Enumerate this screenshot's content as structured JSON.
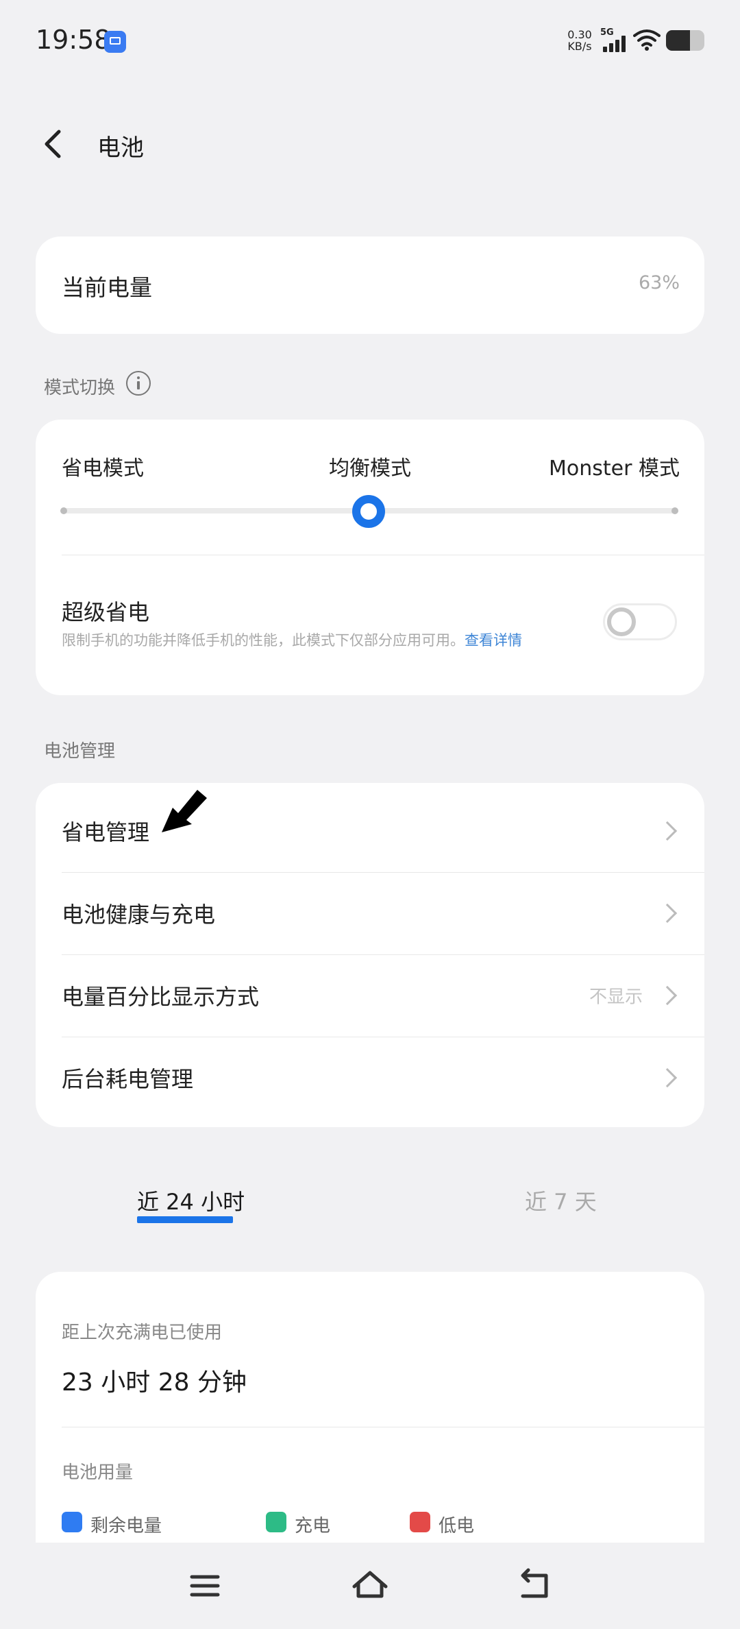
{
  "status_bar": {
    "time": "19:58",
    "net_speed_value": "0.30",
    "net_speed_unit": "KB/s",
    "network_type": "5G",
    "battery_level": 0.63,
    "icons": [
      "screen-cast-icon",
      "cellular-signal-icon",
      "wifi-icon",
      "battery-icon"
    ]
  },
  "header": {
    "title": "电池"
  },
  "battery": {
    "label": "当前电量",
    "value": "63%"
  },
  "mode": {
    "section_title": "模式切换",
    "options": [
      "省电模式",
      "均衡模式",
      "Monster 模式"
    ],
    "selected_index": 1,
    "super_saver_title": "超级省电",
    "super_saver_desc": "限制手机的功能并降低手机的性能，此模式下仅部分应用可用。",
    "super_saver_link": "查看详情",
    "super_saver_enabled": false
  },
  "battery_management": {
    "section_title": "电池管理",
    "items": [
      {
        "label": "省电管理",
        "value": ""
      },
      {
        "label": "电池健康与充电",
        "value": ""
      },
      {
        "label": "电量百分比显示方式",
        "value": "不显示"
      },
      {
        "label": "后台耗电管理",
        "value": ""
      }
    ]
  },
  "tabs": {
    "items": [
      "近 24 小时",
      "近 7 天"
    ],
    "active_index": 0
  },
  "stats": {
    "since_full_label": "距上次充满电已使用",
    "since_full_value": "23 小时 28 分钟",
    "usage_label": "电池用量",
    "legend": [
      {
        "label": "剩余电量",
        "color": "#2f7cf2"
      },
      {
        "label": "充电",
        "color": "#2dbb86"
      },
      {
        "label": "低电",
        "color": "#e34a48"
      }
    ]
  },
  "colors": {
    "accent": "#1b74e8",
    "background": "#f1f1f3"
  },
  "nav_bar": {
    "icons": [
      "menu-icon",
      "home-icon",
      "back-icon"
    ]
  }
}
